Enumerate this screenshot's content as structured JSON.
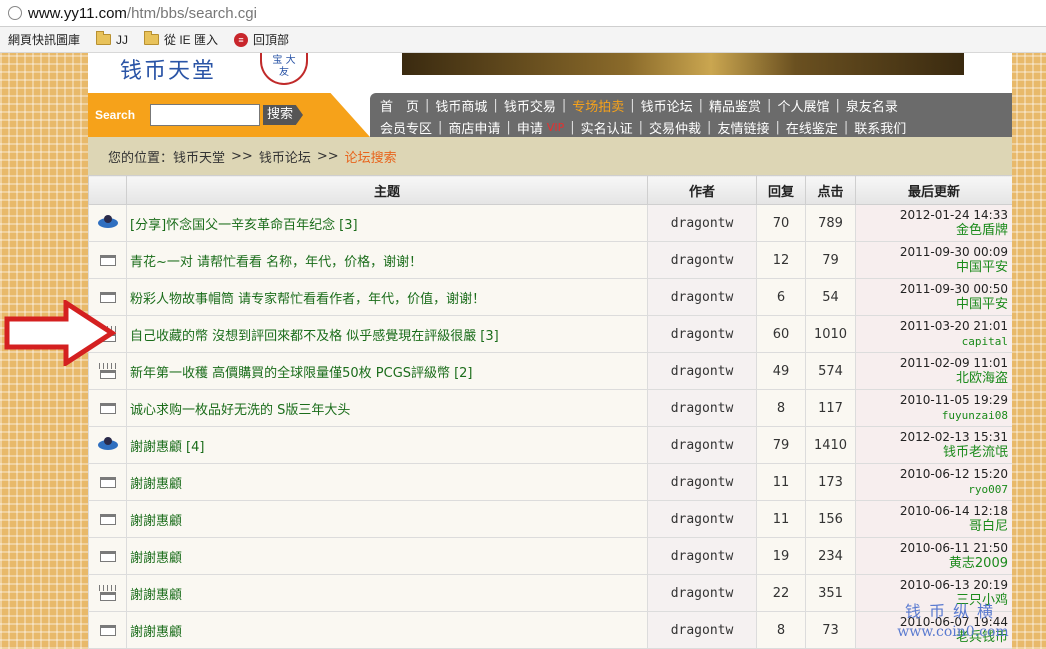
{
  "browser": {
    "url_host": "www.yy11.com",
    "url_path": "/htm/bbs/search.cgi",
    "bookmarks": [
      {
        "label": "網頁快訊圖庫",
        "icon": "none"
      },
      {
        "label": "JJ",
        "icon": "folder-icon"
      },
      {
        "label": "從 IE 匯入",
        "icon": "folder-icon"
      },
      {
        "label": "回頂部",
        "icon": "red-circle-icon"
      }
    ]
  },
  "header": {
    "logo_text": "钱币天堂",
    "seal_text": "宝 大\n友"
  },
  "search": {
    "label": "Search",
    "value": "",
    "button_label": "搜索"
  },
  "nav": {
    "row1": [
      "首　页",
      "钱币商城",
      "钱币交易",
      "专场拍卖",
      "钱币论坛",
      "精品鉴赏",
      "个人展馆",
      "泉友名录"
    ],
    "row2": [
      "会员专区",
      "商店申请",
      "申请",
      "实名认证",
      "交易仲裁",
      "友情链接",
      "在线鉴定",
      "联系我们"
    ],
    "row2_vip": "VIP",
    "active_item": "专场拍卖"
  },
  "breadcrumb": {
    "prefix": "您的位置：",
    "items": [
      "钱币天堂",
      "钱币论坛"
    ],
    "separator": ">>",
    "current": "论坛搜索"
  },
  "table": {
    "headers": {
      "topic": "主题",
      "author": "作者",
      "replies": "回复",
      "clicks": "点击",
      "last_update": "最后更新"
    },
    "rows": [
      {
        "icon": "top",
        "title": "[分享]怀念国父一辛亥革命百年纪念",
        "pages": "[3]",
        "author": "dragontw",
        "replies": "70",
        "clicks": "789",
        "date": "2012-01-24 14:33",
        "by": "金色盾牌",
        "by_mono": false
      },
      {
        "icon": "folder",
        "title": "青花~一对 请帮忙看看 名称，年代，价格，谢谢！",
        "pages": "",
        "author": "dragontw",
        "replies": "12",
        "clicks": "79",
        "date": "2011-09-30 00:09",
        "by": "中国平安",
        "by_mono": false
      },
      {
        "icon": "folder",
        "title": "粉彩人物故事帽筒 请专家帮忙看看作者，年代，价值，谢谢！",
        "pages": "",
        "author": "dragontw",
        "replies": "6",
        "clicks": "54",
        "date": "2011-09-30 00:50",
        "by": "中国平安",
        "by_mono": false
      },
      {
        "icon": "hot",
        "title": "自己收藏的幣 沒想到評回來都不及格 似乎感覺現在評級很嚴",
        "pages": "[3]",
        "author": "dragontw",
        "replies": "60",
        "clicks": "1010",
        "date": "2011-03-20 21:01",
        "by": "capital",
        "by_mono": true
      },
      {
        "icon": "hot",
        "title": "新年第一收穫 高價購買的全球限量僅50枚 PCGS評級幣",
        "pages": "[2]",
        "author": "dragontw",
        "replies": "49",
        "clicks": "574",
        "date": "2011-02-09 11:01",
        "by": "北欧海盗",
        "by_mono": false
      },
      {
        "icon": "folder",
        "title": "诚心求购一枚品好无洗的 S版三年大头",
        "pages": "",
        "author": "dragontw",
        "replies": "8",
        "clicks": "117",
        "date": "2010-11-05 19:29",
        "by": "fuyunzai08",
        "by_mono": true
      },
      {
        "icon": "top",
        "title": "謝謝惠顧",
        "pages": "[4]",
        "author": "dragontw",
        "replies": "79",
        "clicks": "1410",
        "date": "2012-02-13 15:31",
        "by": "钱币老流氓",
        "by_mono": false
      },
      {
        "icon": "folder",
        "title": "謝謝惠顧",
        "pages": "",
        "author": "dragontw",
        "replies": "11",
        "clicks": "173",
        "date": "2010-06-12 15:20",
        "by": "ryo007",
        "by_mono": true
      },
      {
        "icon": "folder",
        "title": "謝謝惠顧",
        "pages": "",
        "author": "dragontw",
        "replies": "11",
        "clicks": "156",
        "date": "2010-06-14 12:18",
        "by": "哥白尼",
        "by_mono": false
      },
      {
        "icon": "folder",
        "title": "謝謝惠顧",
        "pages": "",
        "author": "dragontw",
        "replies": "19",
        "clicks": "234",
        "date": "2010-06-11 21:50",
        "by": "黄志2009",
        "by_mono": false
      },
      {
        "icon": "hot",
        "title": "謝謝惠顧",
        "pages": "",
        "author": "dragontw",
        "replies": "22",
        "clicks": "351",
        "date": "2010-06-13 20:19",
        "by": "三只小鸡",
        "by_mono": false
      },
      {
        "icon": "folder",
        "title": "謝謝惠顧",
        "pages": "",
        "author": "dragontw",
        "replies": "8",
        "clicks": "73",
        "date": "2010-06-07 19:44",
        "by": "老兵钱币",
        "by_mono": false
      }
    ]
  },
  "watermark": {
    "line1": "钱币纵横",
    "line2": "www.coin0.com"
  },
  "colors": {
    "orange": "#f6a21a",
    "nav_gray": "#6b6b6b",
    "link_green": "#1b6d1b",
    "annotation_red": "#d42020"
  }
}
